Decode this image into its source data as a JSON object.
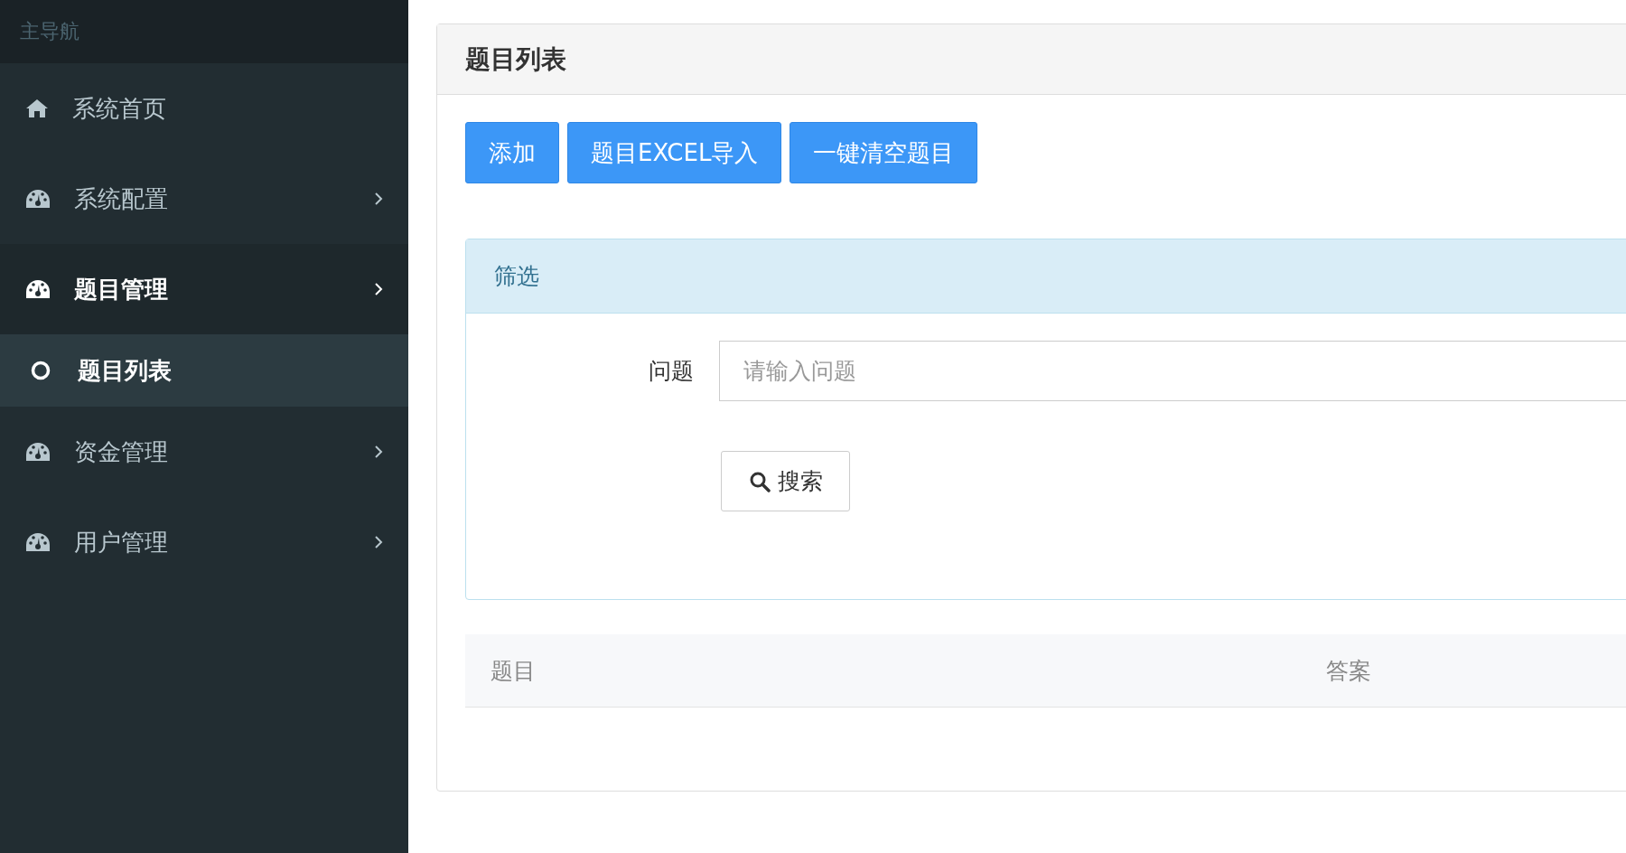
{
  "sidebar": {
    "header": "主导航",
    "items": [
      {
        "label": "系统首页",
        "kind": "home",
        "expanded": false
      },
      {
        "label": "系统配置",
        "kind": "submenu",
        "expanded": false
      },
      {
        "label": "题目管理",
        "kind": "submenu",
        "expanded": true,
        "children": [
          {
            "label": "题目列表",
            "kind": "leaf",
            "selected": true
          }
        ]
      },
      {
        "label": "资金管理",
        "kind": "submenu",
        "expanded": false
      },
      {
        "label": "用户管理",
        "kind": "submenu",
        "expanded": false
      }
    ]
  },
  "panel": {
    "title": "题目列表",
    "buttons": [
      "添加",
      "题目EXCEL导入",
      "一键清空题目"
    ],
    "filter": {
      "title": "筛选",
      "field": {
        "label": "问题",
        "placeholder": "请输入问题"
      },
      "search_button": "搜索"
    },
    "table": {
      "columns": [
        "题目",
        "答案"
      ]
    }
  }
}
